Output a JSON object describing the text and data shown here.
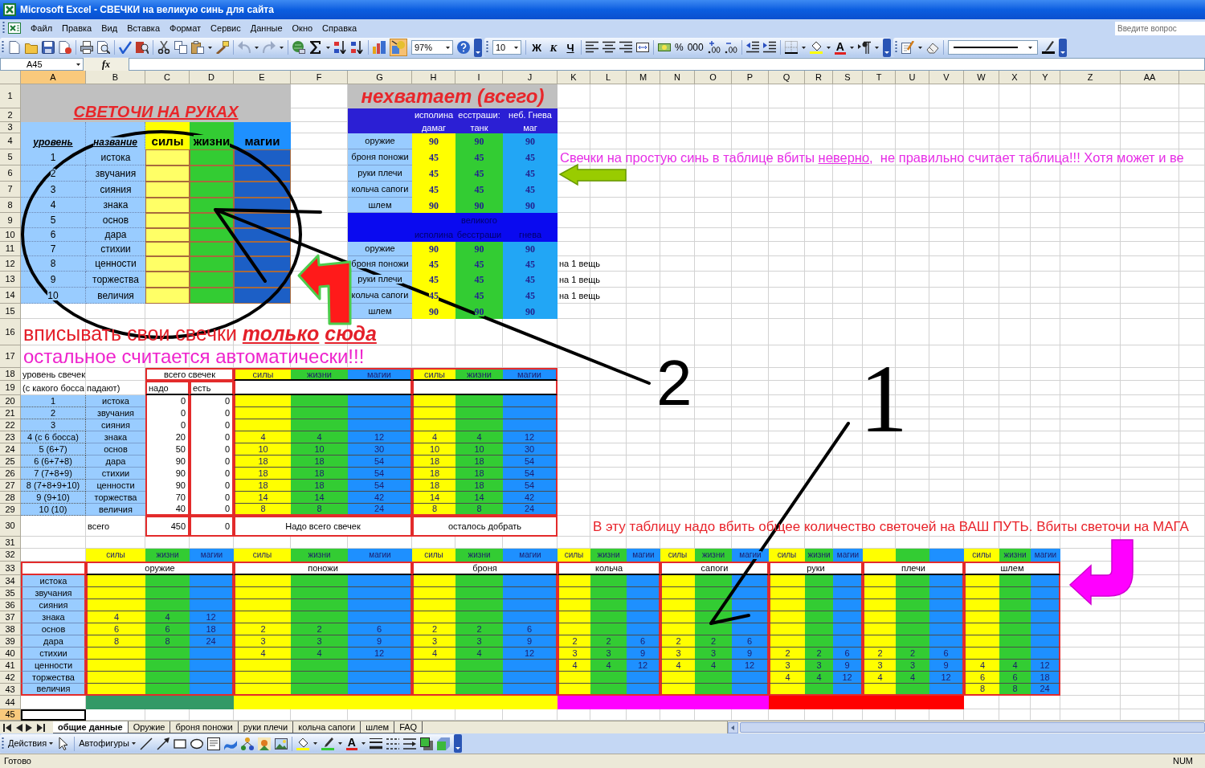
{
  "window": {
    "title": "Microsoft Excel - СВЕЧКИ на великую синь для сайта"
  },
  "menu": [
    "Файл",
    "Правка",
    "Вид",
    "Вставка",
    "Формат",
    "Сервис",
    "Данные",
    "Окно",
    "Справка"
  ],
  "help_search": {
    "placeholder": "Введите вопрос"
  },
  "toolbar": {
    "undo_disabled": true,
    "drawing_pressed": true,
    "zoom": "97%",
    "font_size": "10",
    "style_buttons": [
      "Ж",
      "К",
      "Ч"
    ],
    "number_buttons": [
      "%",
      "000"
    ],
    "font_color_glyph": "A"
  },
  "formula_bar": {
    "name_box": "A45",
    "function_label": "fx"
  },
  "columns": [
    {
      "label": "A",
      "selected": true
    },
    {
      "label": "B",
      "selected": false
    },
    {
      "label": "C",
      "selected": false
    },
    {
      "label": "D",
      "selected": false
    },
    {
      "label": "E",
      "selected": false
    },
    {
      "label": "F",
      "selected": false
    },
    {
      "label": "G",
      "selected": false
    },
    {
      "label": "H",
      "selected": false
    },
    {
      "label": "I",
      "selected": false
    },
    {
      "label": "J",
      "selected": false
    },
    {
      "label": "K",
      "selected": false
    },
    {
      "label": "L",
      "selected": false
    },
    {
      "label": "M",
      "selected": false
    },
    {
      "label": "N",
      "selected": false
    },
    {
      "label": "O",
      "selected": false
    },
    {
      "label": "P",
      "selected": false
    },
    {
      "label": "Q",
      "selected": false
    },
    {
      "label": "R",
      "selected": false
    },
    {
      "label": "S",
      "selected": false
    },
    {
      "label": "T",
      "selected": false
    },
    {
      "label": "U",
      "selected": false
    },
    {
      "label": "V",
      "selected": false
    },
    {
      "label": "W",
      "selected": false
    },
    {
      "label": "X",
      "selected": false
    },
    {
      "label": "Y",
      "selected": false
    },
    {
      "label": "Z",
      "selected": false
    },
    {
      "label": "AA",
      "selected": false
    }
  ],
  "rows": [
    {
      "label": "1",
      "selected": false
    },
    {
      "label": "2",
      "selected": false
    },
    {
      "label": "3",
      "selected": false
    },
    {
      "label": "4",
      "selected": false
    },
    {
      "label": "5",
      "selected": false
    },
    {
      "label": "6",
      "selected": false
    },
    {
      "label": "7",
      "selected": false
    },
    {
      "label": "8",
      "selected": false
    },
    {
      "label": "9",
      "selected": false
    },
    {
      "label": "10",
      "selected": false
    },
    {
      "label": "11",
      "selected": false
    },
    {
      "label": "12",
      "selected": false
    },
    {
      "label": "13",
      "selected": false
    },
    {
      "label": "14",
      "selected": false
    },
    {
      "label": "15",
      "selected": false
    },
    {
      "label": "16",
      "selected": false
    },
    {
      "label": "17",
      "selected": false
    },
    {
      "label": "18",
      "selected": false
    },
    {
      "label": "19",
      "selected": false
    },
    {
      "label": "20",
      "selected": false
    },
    {
      "label": "21",
      "selected": false
    },
    {
      "label": "22",
      "selected": false
    },
    {
      "label": "23",
      "selected": false
    },
    {
      "label": "24",
      "selected": false
    },
    {
      "label": "25",
      "selected": false
    },
    {
      "label": "26",
      "selected": false
    },
    {
      "label": "27",
      "selected": false
    },
    {
      "label": "28",
      "selected": false
    },
    {
      "label": "29",
      "selected": false
    },
    {
      "label": "30",
      "selected": false
    },
    {
      "label": "31",
      "selected": false
    },
    {
      "label": "32",
      "selected": false
    },
    {
      "label": "33",
      "selected": false
    },
    {
      "label": "34",
      "selected": false
    },
    {
      "label": "35",
      "selected": false
    },
    {
      "label": "36",
      "selected": false
    },
    {
      "label": "37",
      "selected": false
    },
    {
      "label": "38",
      "selected": false
    },
    {
      "label": "39",
      "selected": false
    },
    {
      "label": "40",
      "selected": false
    },
    {
      "label": "41",
      "selected": false
    },
    {
      "label": "42",
      "selected": false
    },
    {
      "label": "43",
      "selected": false
    },
    {
      "label": "44",
      "selected": false
    },
    {
      "label": "45",
      "selected": true
    }
  ],
  "hands_table": {
    "title": "СВЕТОЧИ НА РУКАХ",
    "headers": [
      "уровень",
      "название",
      "силы",
      "жизни",
      "магии"
    ],
    "rows": [
      {
        "level": "1",
        "name": "истока"
      },
      {
        "level": "2",
        "name": "звучания"
      },
      {
        "level": "3",
        "name": "сияния"
      },
      {
        "level": "4",
        "name": "знака"
      },
      {
        "level": "5",
        "name": "основ"
      },
      {
        "level": "6",
        "name": "дара"
      },
      {
        "level": "7",
        "name": "стихии"
      },
      {
        "level": "8",
        "name": "ценности"
      },
      {
        "level": "9",
        "name": "торжества"
      },
      {
        "level": "10",
        "name": "величия"
      }
    ]
  },
  "shortage_table": {
    "title": "нехватает (всего)",
    "sections": [
      {
        "kind": "bright",
        "headers": [
          [
            "исполина",
            "дамаг"
          ],
          [
            "есстраши:",
            "танк"
          ],
          [
            "неб. Гнева",
            "маг"
          ]
        ],
        "rows": [
          {
            "item": "оружие",
            "values": [
              "90",
              "90",
              "90"
            ]
          },
          {
            "item": "броня поножи",
            "values": [
              "45",
              "45",
              "45"
            ]
          },
          {
            "item": "руки плечи",
            "values": [
              "45",
              "45",
              "45"
            ]
          },
          {
            "item": "кольча сапоги",
            "values": [
              "45",
              "45",
              "45"
            ]
          },
          {
            "item": "шлем",
            "values": [
              "90",
              "90",
              "90"
            ]
          }
        ]
      },
      {
        "kind": "faded",
        "headers": [
          [
            "исполина"
          ],
          [
            "великого",
            "бесстраши"
          ],
          [
            "гнева"
          ]
        ],
        "rows": [
          {
            "item": "оружие",
            "values": [
              "90",
              "90",
              "90"
            ]
          },
          {
            "item": "броня поножи",
            "values": [
              "45",
              "45",
              "45"
            ],
            "note": "на 1 вещь"
          },
          {
            "item": "руки плечи",
            "values": [
              "45",
              "45",
              "45"
            ],
            "note": "на 1 вещь"
          },
          {
            "item": "кольча сапоги",
            "values": [
              "45",
              "45",
              "45"
            ],
            "note": "на 1 вещь"
          },
          {
            "item": "шлем",
            "values": [
              "90",
              "90",
              "90"
            ]
          }
        ]
      }
    ]
  },
  "warning_note": {
    "text": "Свечки на простую синь в таблице вбиты ",
    "underlined": "неверно",
    "rest": ",  не правильно считает таблица!!! Хотя может и ве"
  },
  "instruction": {
    "text": "вписывать свои свечки",
    "emphasis": [
      "только",
      "сюда"
    ]
  },
  "auto_note": "остальное считается автоматически!!!",
  "totals_table": {
    "level_header": [
      "уровень свечек",
      "(с какого босса падают)"
    ],
    "total_header": "всего свечек",
    "total_columns": [
      "надо",
      "есть"
    ],
    "stat_groups": [
      [
        "силы",
        "жизни",
        "магии"
      ],
      [
        "силы",
        "жизни",
        "магии"
      ]
    ],
    "rows": [
      {
        "level": "1",
        "name": "истока",
        "need": "0",
        "have": "0"
      },
      {
        "level": "2",
        "name": "звучания",
        "need": "0",
        "have": "0"
      },
      {
        "level": "3",
        "name": "сияния",
        "need": "0",
        "have": "0"
      },
      {
        "level": "4 (с 6 босса)",
        "name": "знака",
        "need": "20",
        "have": "0",
        "required": [
          "4",
          "4",
          "12"
        ],
        "remaining": [
          "4",
          "4",
          "12"
        ]
      },
      {
        "level": "5 (6+7)",
        "name": "основ",
        "need": "50",
        "have": "0",
        "required": [
          "10",
          "10",
          "30"
        ],
        "remaining": [
          "10",
          "10",
          "30"
        ]
      },
      {
        "level": "6 (6+7+8)",
        "name": "дара",
        "need": "90",
        "have": "0",
        "required": [
          "18",
          "18",
          "54"
        ],
        "remaining": [
          "18",
          "18",
          "54"
        ]
      },
      {
        "level": "7 (7+8+9)",
        "name": "стихии",
        "need": "90",
        "have": "0",
        "required": [
          "18",
          "18",
          "54"
        ],
        "remaining": [
          "18",
          "18",
          "54"
        ]
      },
      {
        "level": "8 (7+8+9+10)",
        "name": "ценности",
        "need": "90",
        "have": "0",
        "required": [
          "18",
          "18",
          "54"
        ],
        "remaining": [
          "18",
          "18",
          "54"
        ]
      },
      {
        "level": "9 (9+10)",
        "name": "торжества",
        "need": "70",
        "have": "0",
        "required": [
          "14",
          "14",
          "42"
        ],
        "remaining": [
          "14",
          "14",
          "42"
        ]
      },
      {
        "level": "10 (10)",
        "name": "величия",
        "need": "40",
        "have": "0",
        "required": [
          "8",
          "8",
          "24"
        ],
        "remaining": [
          "8",
          "8",
          "24"
        ]
      }
    ],
    "footer": {
      "label": "всего",
      "need": "450",
      "have": "0",
      "captions": [
        "Надо всего свечек",
        "осталось добрать"
      ]
    }
  },
  "path_note": "В эту таблицу надо вбить общее количество светочей на ВАШ ПУТЬ. Вбиты светочи на МАГА",
  "gear_table": {
    "groups": [
      {
        "name": "оружие",
        "headers": [
          "силы",
          "жизни",
          "магии"
        ],
        "color": "#339966"
      },
      {
        "name": "поножи",
        "headers": [
          "силы",
          "жизни",
          "магии"
        ],
        "color": "#ffff00"
      },
      {
        "name": "броня",
        "headers": [
          "силы",
          "жизни",
          "магии"
        ],
        "color": "#ffff00"
      },
      {
        "name": "кольча",
        "headers": [
          "силы",
          "жизни",
          "магии"
        ],
        "color": "#ff00ff"
      },
      {
        "name": "сапоги",
        "headers": [
          "силы",
          "жизни",
          "магии"
        ],
        "color": "#ff00ff"
      },
      {
        "name": "руки",
        "headers": [
          "силы",
          "жизни",
          "магии"
        ],
        "color": "#ff0000"
      },
      {
        "name": "плечи",
        "color": "#ff0000"
      },
      {
        "name": "шлем",
        "headers": [
          "силы",
          "жизни",
          "магии"
        ]
      }
    ],
    "rows": [
      {
        "name": "истока"
      },
      {
        "name": "звучания"
      },
      {
        "name": "сияния"
      },
      {
        "name": "знака",
        "weapon": [
          "4",
          "4",
          "12"
        ]
      },
      {
        "name": "основ",
        "weapon": [
          "6",
          "6",
          "18"
        ],
        "greaves": [
          "2",
          "2",
          "6"
        ],
        "armor": [
          "2",
          "2",
          "6"
        ]
      },
      {
        "name": "дара",
        "weapon": [
          "8",
          "8",
          "24"
        ],
        "greaves": [
          "3",
          "3",
          "9"
        ],
        "armor": [
          "3",
          "3",
          "9"
        ],
        "rings": [
          "2",
          "2",
          "6"
        ],
        "boots": [
          "2",
          "2",
          "6"
        ]
      },
      {
        "name": "стихии",
        "greaves": [
          "4",
          "4",
          "12"
        ],
        "armor": [
          "4",
          "4",
          "12"
        ],
        "rings": [
          "3",
          "3",
          "9"
        ],
        "boots": [
          "3",
          "3",
          "9"
        ],
        "hands": [
          "2",
          "2",
          "6"
        ],
        "shoulders": [
          "2",
          "2",
          "6"
        ]
      },
      {
        "name": "ценности",
        "rings": [
          "4",
          "4",
          "12"
        ],
        "boots": [
          "4",
          "4",
          "12"
        ],
        "hands": [
          "3",
          "3",
          "9"
        ],
        "shoulders": [
          "3",
          "3",
          "9"
        ],
        "helmet": [
          "4",
          "4",
          "12"
        ]
      },
      {
        "name": "торжества",
        "hands": [
          "4",
          "4",
          "12"
        ],
        "shoulders": [
          "4",
          "4",
          "12"
        ],
        "helmet": [
          "6",
          "6",
          "18"
        ]
      },
      {
        "name": "величия",
        "helmet": [
          "8",
          "8",
          "24"
        ]
      }
    ]
  },
  "annotations": {
    "labels": [
      "2",
      "1"
    ]
  },
  "sheet_tabs": [
    {
      "label": "общие данные",
      "selected": true
    },
    {
      "label": "Оружие",
      "selected": false
    },
    {
      "label": "броня поножи",
      "selected": false
    },
    {
      "label": "руки плечи",
      "selected": false
    },
    {
      "label": "кольча сапоги",
      "selected": false
    },
    {
      "label": "шлем",
      "selected": false
    },
    {
      "label": "FAQ",
      "selected": false
    }
  ],
  "drawing_toolbar": {
    "actions": "Действия",
    "autoshapes": "Автофигуры",
    "font_color_glyph": "A"
  },
  "status_bar": {
    "left": "Готово",
    "right": "NUM"
  }
}
